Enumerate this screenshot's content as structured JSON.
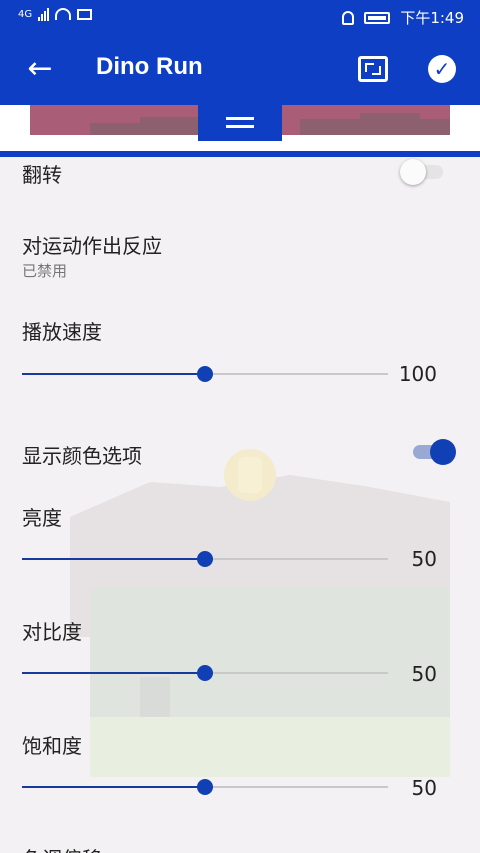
{
  "status_bar": {
    "network": "4G",
    "time": "下午1:49"
  },
  "app_bar": {
    "title": "Dino Run"
  },
  "settings": {
    "flip": {
      "label": "翻转",
      "enabled": false
    },
    "motion": {
      "label": "对运动作出反应",
      "status": "已禁用"
    },
    "speed": {
      "label": "播放速度",
      "value": "100",
      "level": 0.5
    },
    "color_options": {
      "label": "显示颜色选项",
      "enabled": true
    },
    "brightness": {
      "label": "亮度",
      "value": "50",
      "level": 0.5
    },
    "contrast": {
      "label": "对比度",
      "value": "50",
      "level": 0.5
    },
    "saturation": {
      "label": "饱和度",
      "value": "50",
      "level": 0.5
    },
    "hue": {
      "label": "色调偏移"
    }
  },
  "colors": {
    "primary": "#0d3ec4",
    "slider": "#1140b4"
  }
}
